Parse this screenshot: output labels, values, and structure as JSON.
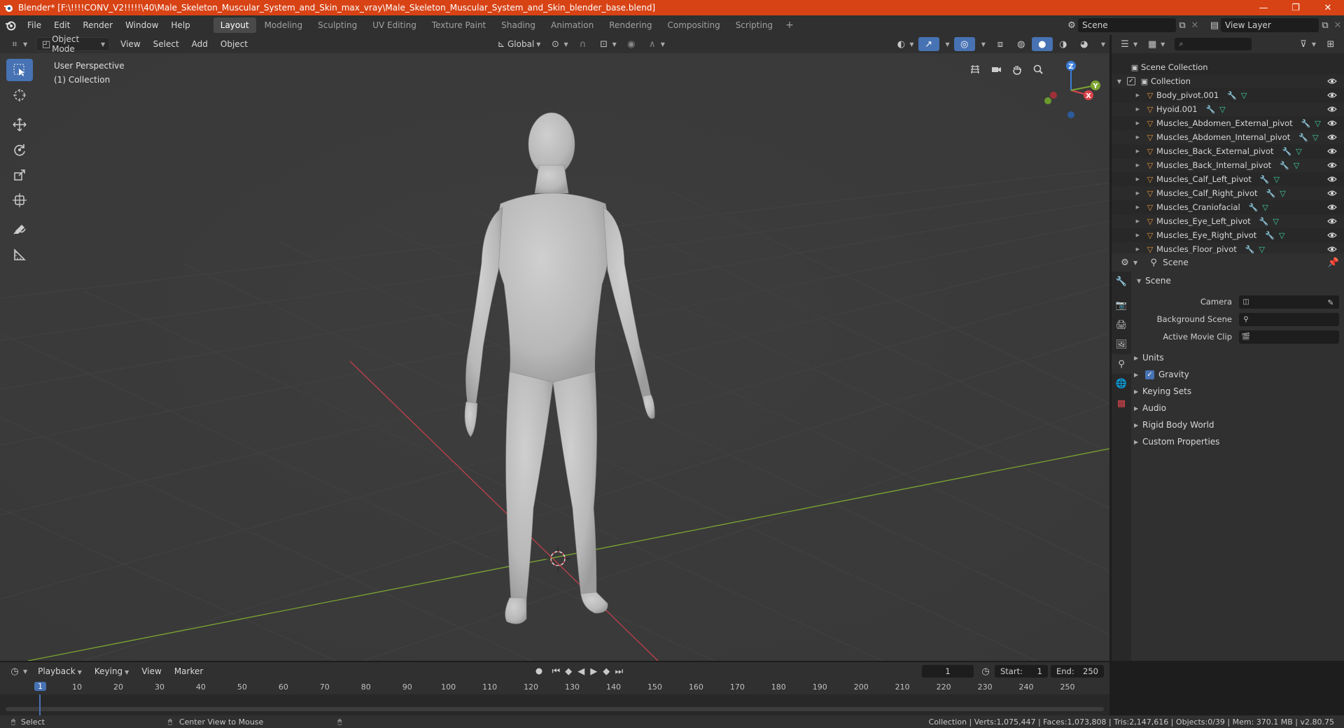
{
  "window": {
    "title": "Blender* [F:\\!!!!CONV_V2!!!!!\\40\\Male_Skeleton_Muscular_System_and_Skin_max_vray\\Male_Skeleton_Muscular_System_and_Skin_blender_base.blend]"
  },
  "menu": {
    "items": [
      "File",
      "Edit",
      "Render",
      "Window",
      "Help"
    ]
  },
  "workspaces": [
    "Layout",
    "Modeling",
    "Sculpting",
    "UV Editing",
    "Texture Paint",
    "Shading",
    "Animation",
    "Rendering",
    "Compositing",
    "Scripting"
  ],
  "scene_selector": {
    "value": "Scene"
  },
  "view_layer_selector": {
    "value": "View Layer"
  },
  "viewport_header": {
    "mode": "Object Mode",
    "menus": [
      "View",
      "Select",
      "Add",
      "Object"
    ],
    "transform_orientation": "Global"
  },
  "viewport": {
    "perspective": "User Perspective",
    "collection": "(1) Collection",
    "gizmo": {
      "x": "X",
      "y": "Y",
      "z": "Z"
    }
  },
  "outliner": {
    "root": "Scene Collection",
    "collection": "Collection",
    "objects": [
      "Body_pivot.001",
      "Hyoid.001",
      "Muscles_Abdomen_External_pivot",
      "Muscles_Abdomen_Internal_pivot",
      "Muscles_Back_External_pivot",
      "Muscles_Back_Internal_pivot",
      "Muscles_Calf_Left_pivot",
      "Muscles_Calf_Right_pivot",
      "Muscles_Craniofacial",
      "Muscles_Eye_Left_pivot",
      "Muscles_Eye_Right_pivot",
      "Muscles_Floor_pivot"
    ]
  },
  "properties": {
    "context": "Scene",
    "panel": "Scene",
    "fields": {
      "camera": "Camera",
      "background_scene": "Background Scene",
      "active_movie_clip": "Active Movie Clip"
    },
    "subpanels": [
      "Units",
      "Gravity",
      "Keying Sets",
      "Audio",
      "Rigid Body World",
      "Custom Properties"
    ],
    "gravity_enabled": true
  },
  "timeline": {
    "menus": [
      "Playback",
      "Keying",
      "View",
      "Marker"
    ],
    "current_frame": "1",
    "start_label": "Start:",
    "start": "1",
    "end_label": "End:",
    "end": "250",
    "ticks": [
      "1",
      "10",
      "20",
      "30",
      "40",
      "50",
      "60",
      "70",
      "80",
      "90",
      "100",
      "110",
      "120",
      "130",
      "140",
      "150",
      "160",
      "170",
      "180",
      "190",
      "200",
      "210",
      "220",
      "230",
      "240",
      "250"
    ]
  },
  "statusbar": {
    "left_action": "Select",
    "middle_action": "Center View to Mouse",
    "stats": "Collection | Verts:1,075,447 | Faces:1,073,808 | Tris:2,147,616 | Objects:0/39 | Mem: 370.1 MB | v2.80.75"
  },
  "colors": {
    "titlebar": "#d84315",
    "active_tool": "#4772b3",
    "x_axis": "#d9434d",
    "y_axis": "#7ca531",
    "z_axis": "#3b7dd8"
  }
}
